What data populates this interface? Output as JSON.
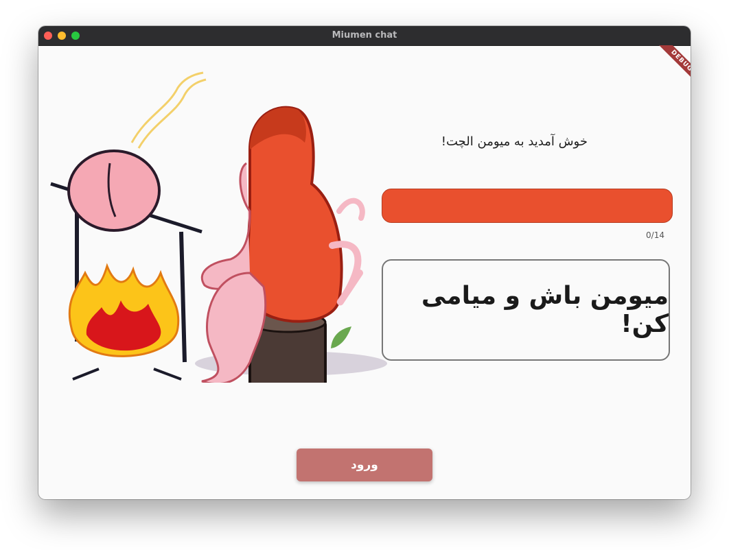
{
  "window": {
    "title": "Miumen chat"
  },
  "debug_banner": "DEBUG",
  "login": {
    "welcome_text": "خوش آمدید به میومن الچت!",
    "name_input_value": "",
    "char_counter": "0/14",
    "slogan": "میومن باش و میامی کن!",
    "login_button_label": "ورود"
  },
  "colors": {
    "accent": "#e9502e",
    "button": "#c27370",
    "window_background": "#fafafa",
    "titlebar": "#2d2d2f"
  },
  "icons": [
    "close-icon",
    "minimize-icon",
    "zoom-icon",
    "monkey-fire-illustration"
  ]
}
